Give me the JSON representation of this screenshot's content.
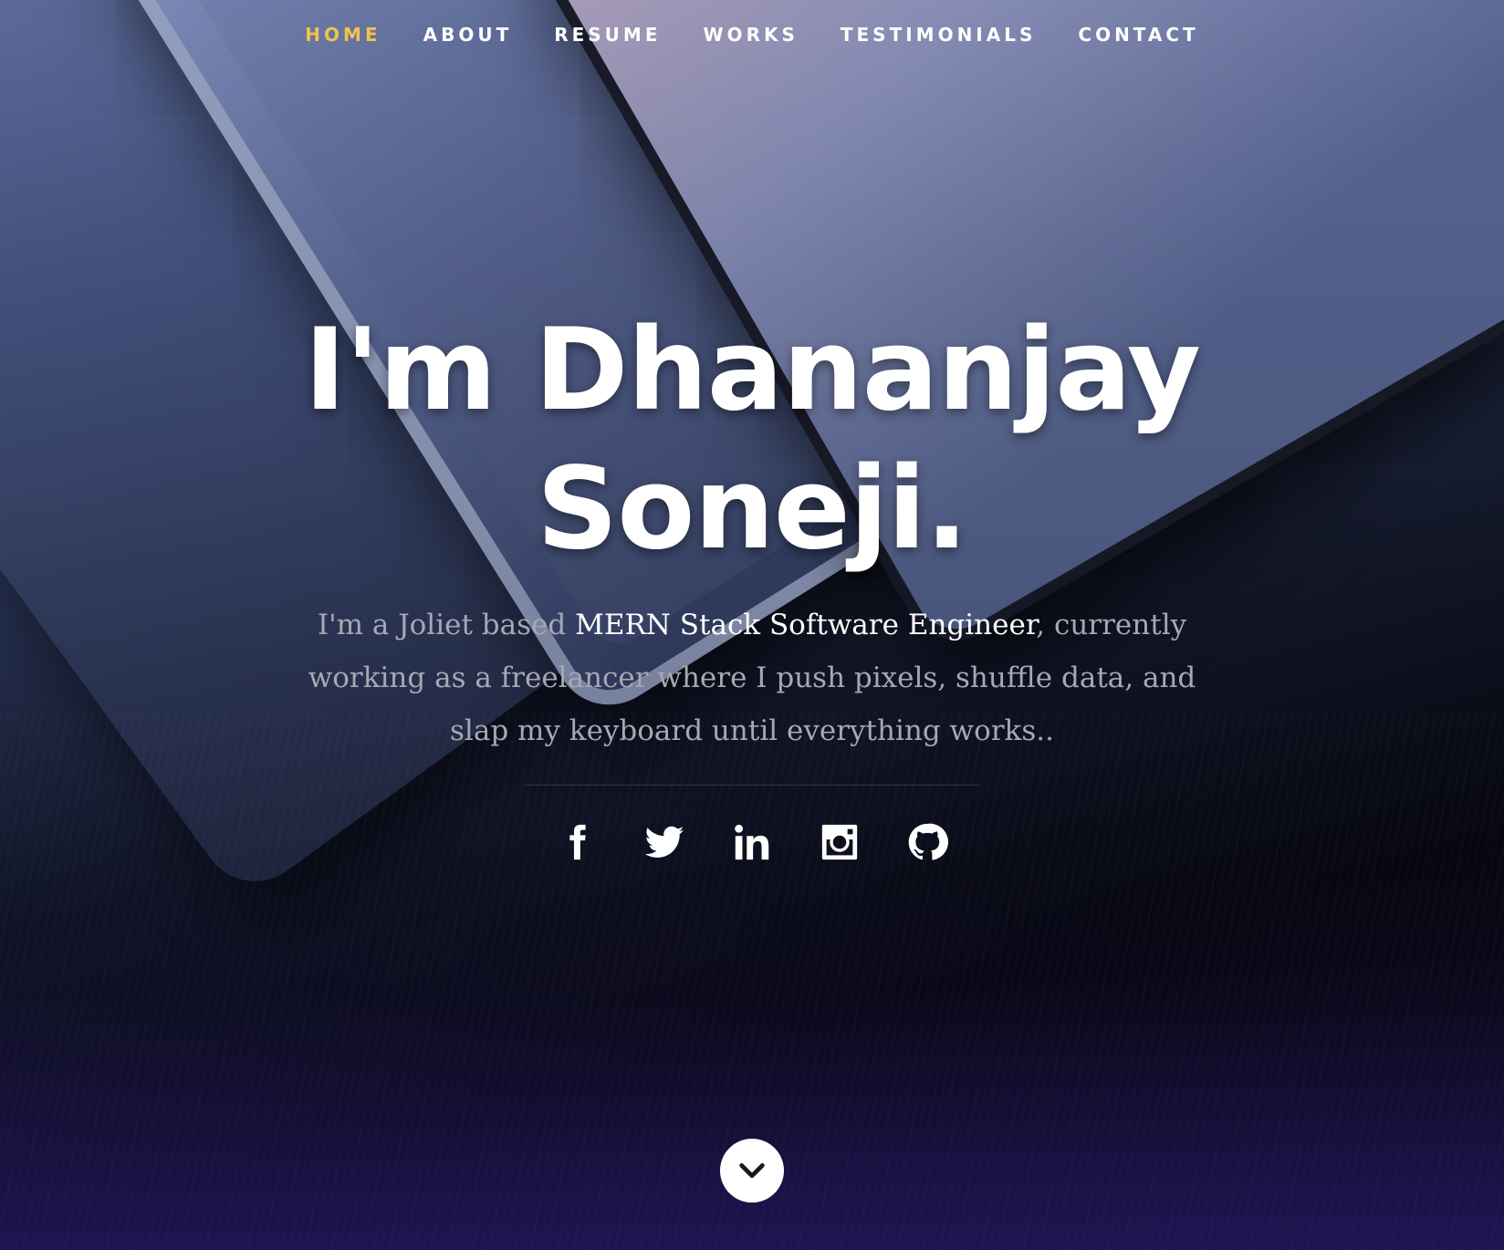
{
  "nav": {
    "items": [
      {
        "label": "Home",
        "active": true
      },
      {
        "label": "About",
        "active": false
      },
      {
        "label": "Resume",
        "active": false
      },
      {
        "label": "Works",
        "active": false
      },
      {
        "label": "Testimonials",
        "active": false
      },
      {
        "label": "Contact",
        "active": false
      }
    ],
    "active_color": "#f0c24c"
  },
  "banner": {
    "headline": "I'm Dhananjay Soneji.",
    "intro_prefix": "I'm a Joliet based ",
    "intro_highlight": "MERN Stack Software Engineer",
    "intro_suffix": ", currently working as a freelancer where I push pixels, shuffle data, and slap my keyboard until everything works.."
  },
  "social": [
    {
      "icon": "facebook-icon"
    },
    {
      "icon": "twitter-icon"
    },
    {
      "icon": "linkedin-icon"
    },
    {
      "icon": "instagram-icon"
    },
    {
      "icon": "github-icon"
    }
  ],
  "scroll_icon": "chevron-down-icon"
}
